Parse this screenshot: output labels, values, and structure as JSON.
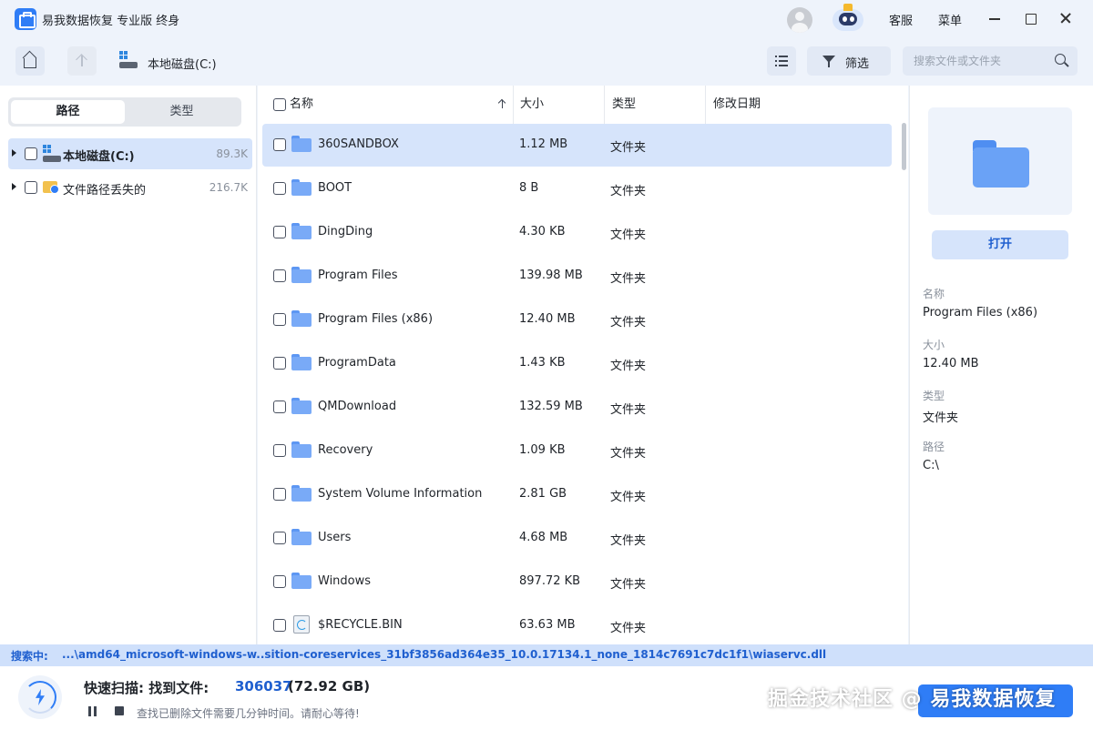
{
  "app": {
    "title": "易我数据恢复 专业版 终身"
  },
  "titlebar": {
    "service_label": "客服",
    "menu_label": "菜单"
  },
  "toolbar": {
    "breadcrumb": "本地磁盘(C:)",
    "filter_label": "筛选",
    "search_placeholder": "搜索文件或文件夹"
  },
  "sidebar": {
    "tabs": [
      {
        "label": "路径",
        "active": true
      },
      {
        "label": "类型",
        "active": false
      }
    ],
    "items": [
      {
        "label": "本地磁盘(C:)",
        "count": "89.3K",
        "selected": true
      },
      {
        "label": "文件路径丢失的",
        "count": "216.7K",
        "selected": false
      }
    ]
  },
  "file_list": {
    "columns": {
      "name": "名称",
      "size": "大小",
      "type": "类型",
      "modified": "修改日期"
    },
    "rows": [
      {
        "name": "360SANDBOX",
        "size": "1.12 MB",
        "type": "文件夹",
        "icon": "folder-icon"
      },
      {
        "name": "BOOT",
        "size": "8 B",
        "type": "文件夹",
        "icon": "folder-icon"
      },
      {
        "name": "DingDing",
        "size": "4.30 KB",
        "type": "文件夹",
        "icon": "folder-icon"
      },
      {
        "name": "Program Files",
        "size": "139.98 MB",
        "type": "文件夹",
        "icon": "folder-icon"
      },
      {
        "name": "Program Files (x86)",
        "size": "12.40 MB",
        "type": "文件夹",
        "icon": "folder-icon"
      },
      {
        "name": "ProgramData",
        "size": "1.43 KB",
        "type": "文件夹",
        "icon": "folder-icon"
      },
      {
        "name": "QMDownload",
        "size": "132.59 MB",
        "type": "文件夹",
        "icon": "folder-icon"
      },
      {
        "name": "Recovery",
        "size": "1.09 KB",
        "type": "文件夹",
        "icon": "folder-icon"
      },
      {
        "name": "System Volume Information",
        "size": "2.81 GB",
        "type": "文件夹",
        "icon": "folder-icon"
      },
      {
        "name": "Users",
        "size": "4.68 MB",
        "type": "文件夹",
        "icon": "folder-icon"
      },
      {
        "name": "Windows",
        "size": "897.72 KB",
        "type": "文件夹",
        "icon": "folder-icon"
      },
      {
        "name": "$RECYCLE.BIN",
        "size": "63.63 MB",
        "type": "文件夹",
        "icon": "recycle-bin-icon"
      }
    ]
  },
  "details": {
    "open_label": "打开",
    "name_label": "名称",
    "name_value": "Program Files (x86)",
    "size_label": "大小",
    "size_value": "12.40 MB",
    "type_label": "类型",
    "type_value": "文件夹",
    "path_label": "路径",
    "path_value": "C:\\"
  },
  "scan": {
    "label": "搜索中:",
    "path": "...\\amd64_microsoft-windows-w..sition-coreservices_31bf3856ad364e35_10.0.17134.1_none_1814c7691c7dc1f1\\wiaservc.dll",
    "title": "快速扫描: 找到文件:",
    "count": "306037",
    "size": "(72.92 GB)",
    "hint": "查找已删除文件需要几分钟时间。请耐心等待!"
  },
  "watermark": "掘金技术社区 @ 易我数据恢复",
  "colors": {
    "accent": "#2f7df6",
    "selected_row": "#d6e4fb",
    "background": "#eef3fb"
  }
}
